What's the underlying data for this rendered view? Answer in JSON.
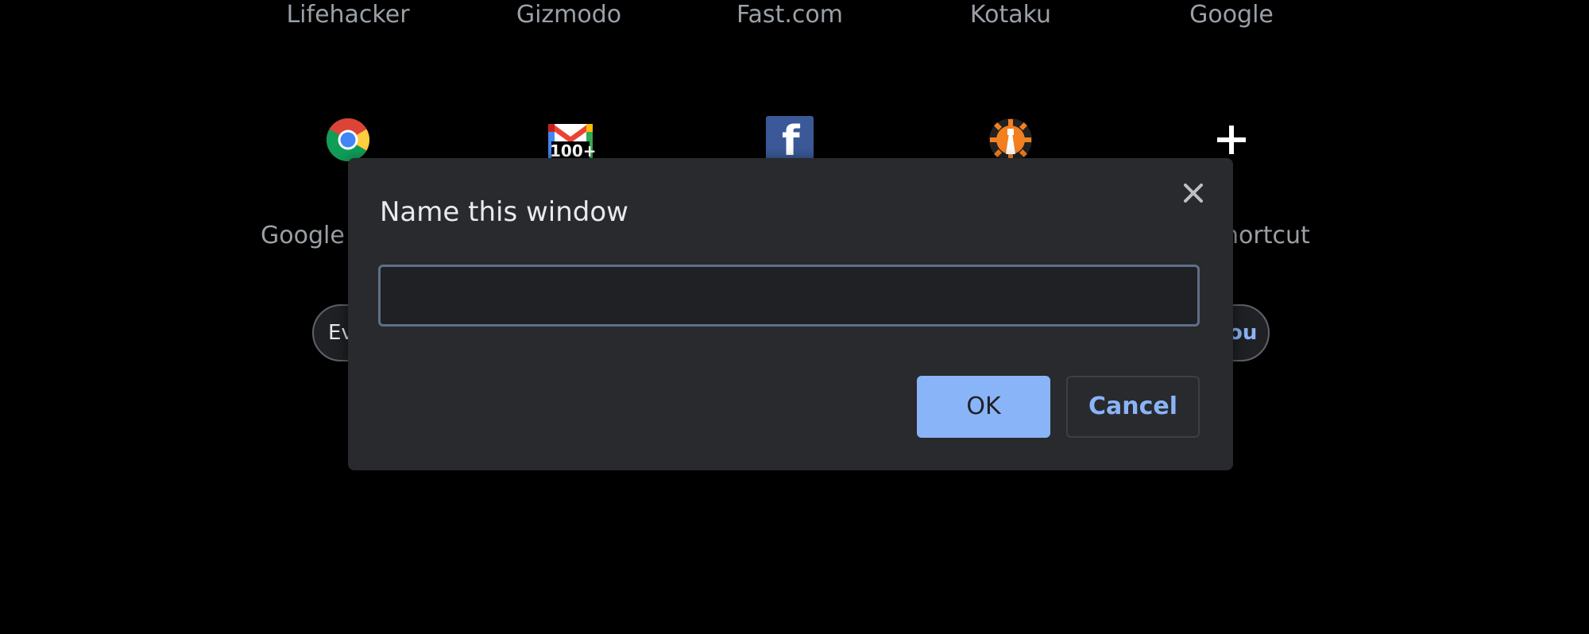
{
  "top_row": [
    {
      "label": "Lifehacker"
    },
    {
      "label": "Gizmodo"
    },
    {
      "label": "Fast.com"
    },
    {
      "label": "Kotaku"
    },
    {
      "label": "Google"
    }
  ],
  "shortcuts": [
    {
      "icon": "chrome-icon",
      "label": "Google"
    },
    {
      "icon": "gmail-icon",
      "badge": "100+"
    },
    {
      "icon": "facebook-icon",
      "glyph": "f"
    },
    {
      "icon": "cloudflare-tower-icon"
    },
    {
      "icon": "plus-icon",
      "label": "hortcut"
    }
  ],
  "chips": {
    "left_text": "Ev",
    "right_text": "ou"
  },
  "dialog": {
    "title": "Name this window",
    "input_value": "",
    "ok_label": "OK",
    "cancel_label": "Cancel",
    "close_icon": "close-icon"
  },
  "colors": {
    "background": "#000000",
    "dialog_bg": "#292a2d",
    "accent": "#8ab4f8",
    "text_muted": "#9aa0a6",
    "text_primary": "#e8eaed"
  }
}
